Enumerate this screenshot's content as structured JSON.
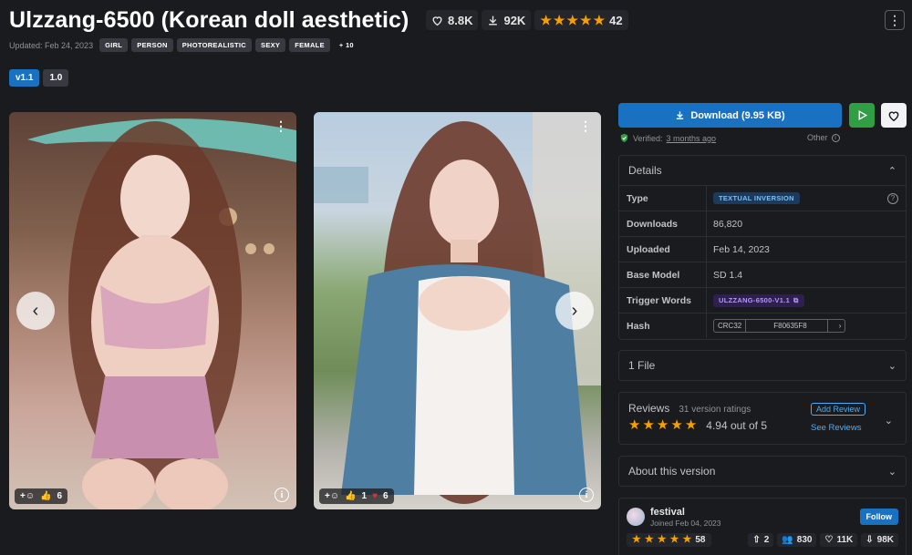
{
  "model": {
    "title": "Ulzzang-6500 (Korean doll aesthetic)",
    "likes": "8.8K",
    "downloads": "92K",
    "rating_count": "42",
    "updated": "Updated: Feb 24, 2023",
    "tags": [
      "GIRL",
      "PERSON",
      "PHOTOREALISTIC",
      "SEXY",
      "FEMALE"
    ],
    "more_tags": "+ 10"
  },
  "versions": [
    {
      "label": "v1.1",
      "active": true
    },
    {
      "label": "1.0",
      "active": false
    }
  ],
  "gallery": [
    {
      "reactions": {
        "thumbs": "6"
      }
    },
    {
      "reactions": {
        "thumbs": "1",
        "hearts": "6"
      }
    }
  ],
  "download": {
    "label": "Download (9.95 KB)",
    "verified_prefix": "Verified:",
    "verified_time": "3 months ago",
    "other": "Other"
  },
  "details": {
    "heading": "Details",
    "rows": {
      "type": {
        "key": "Type",
        "value": "TEXTUAL INVERSION"
      },
      "downloads": {
        "key": "Downloads",
        "value": "86,820"
      },
      "uploaded": {
        "key": "Uploaded",
        "value": "Feb 14, 2023"
      },
      "base_model": {
        "key": "Base Model",
        "value": "SD 1.4"
      },
      "trigger": {
        "key": "Trigger Words",
        "value": "ULZZANG-6500-V1.1"
      },
      "hash": {
        "key": "Hash",
        "algo": "CRC32",
        "value": "F80635F8"
      }
    }
  },
  "files": {
    "heading": "1 File"
  },
  "reviews": {
    "heading": "Reviews",
    "count": "31 version ratings",
    "score": "4.94 out of 5",
    "add_label": "Add Review",
    "see_label": "See Reviews"
  },
  "about": {
    "heading": "About this version"
  },
  "creator": {
    "name": "festival",
    "joined": "Joined Feb 04, 2023",
    "follow_label": "Follow",
    "rating_count": "58",
    "uploads": "2",
    "followers": "830",
    "likes": "11K",
    "downloads": "98K"
  },
  "colors": {
    "accent": "#1971c2",
    "star": "#f59f00",
    "success": "#2f9e44",
    "background": "#1a1b1e"
  }
}
